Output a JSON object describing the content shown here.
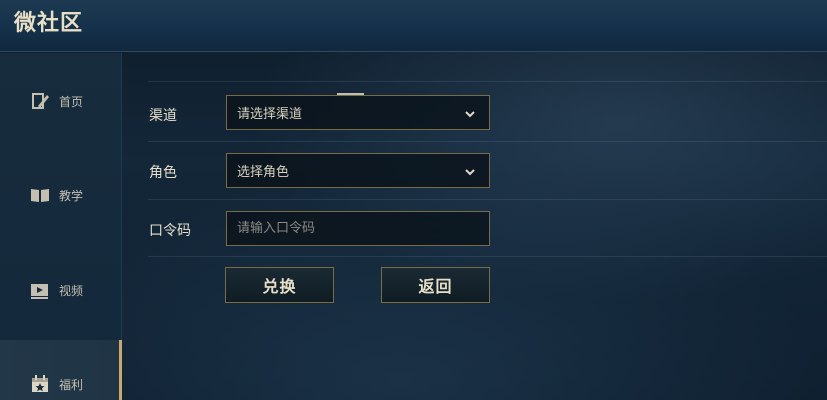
{
  "header": {
    "title": "微社区"
  },
  "sidebar": {
    "items": [
      {
        "label": "首页",
        "icon": "edit-book-icon"
      },
      {
        "label": "教学",
        "icon": "open-book-icon"
      },
      {
        "label": "视频",
        "icon": "video-play-icon"
      },
      {
        "label": "福利",
        "icon": "gift-calendar-icon",
        "active": true
      }
    ]
  },
  "form": {
    "channel": {
      "label": "渠道",
      "value": "请选择渠道"
    },
    "role": {
      "label": "角色",
      "value": "选择角色"
    },
    "code": {
      "label": "口令码",
      "placeholder": "请输入口令码",
      "value": ""
    },
    "redeem_label": "兑换",
    "back_label": "返回"
  },
  "colors": {
    "accent_gold": "#c8aa6e",
    "border_gold": "#7a6a45",
    "background": "#132739"
  }
}
